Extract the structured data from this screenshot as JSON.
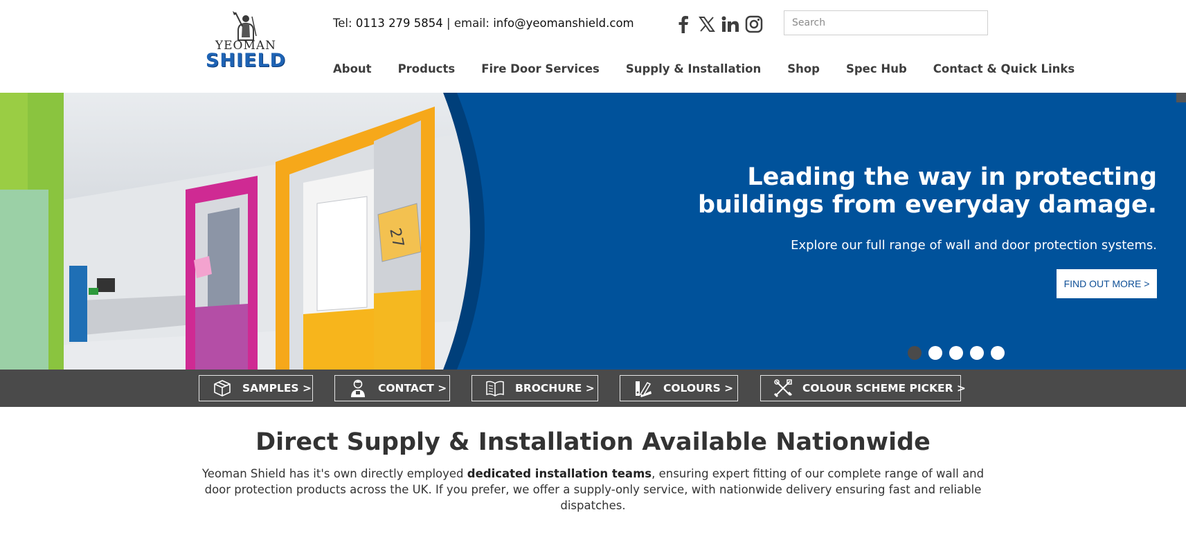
{
  "logo": {
    "top": "YEOMAN",
    "bottom": "SHIELD"
  },
  "contact": {
    "tel_label": "Tel:",
    "tel_value": "0113 279 5854",
    "separator": "|",
    "email_label": "email:",
    "email_value": "info@yeomanshield.com"
  },
  "socials": [
    "facebook-icon",
    "x-icon",
    "linkedin-icon",
    "instagram-icon"
  ],
  "search": {
    "placeholder": "Search",
    "value": ""
  },
  "nav": {
    "items": [
      {
        "label": "About"
      },
      {
        "label": "Products"
      },
      {
        "label": "Fire Door Services"
      },
      {
        "label": "Supply & Installation"
      },
      {
        "label": "Shop"
      },
      {
        "label": "Spec Hub"
      },
      {
        "label": "Contact & Quick Links"
      }
    ]
  },
  "hero": {
    "title_line1": "Leading the way in protecting",
    "title_line2": "buildings from everyday damage.",
    "subtitle": "Explore our full range of wall and door protection systems.",
    "button": "FIND OUT MORE >",
    "slides_count": 5,
    "active_slide": 1
  },
  "quicklinks": {
    "samples": "SAMPLES >",
    "contact": "CONTACT >",
    "brochure": "BROCHURE >",
    "colours": "COLOURS >",
    "picker": "COLOUR SCHEME PICKER >"
  },
  "content": {
    "title": "Direct Supply & Installation Available Nationwide",
    "text_part1": "Yeoman Shield has it's own directly employed ",
    "text_bold": "dedicated installation teams",
    "text_part2": ", ensuring expert fitting of our complete range of wall and door protection products across the UK. If you prefer, we offer a supply-only service, with nationwide delivery ensuring fast and reliable dispatches."
  },
  "colors": {
    "brand_blue": "#00529b",
    "bar_grey": "#4a4a4a",
    "logo_blue": "#1e63b4"
  }
}
